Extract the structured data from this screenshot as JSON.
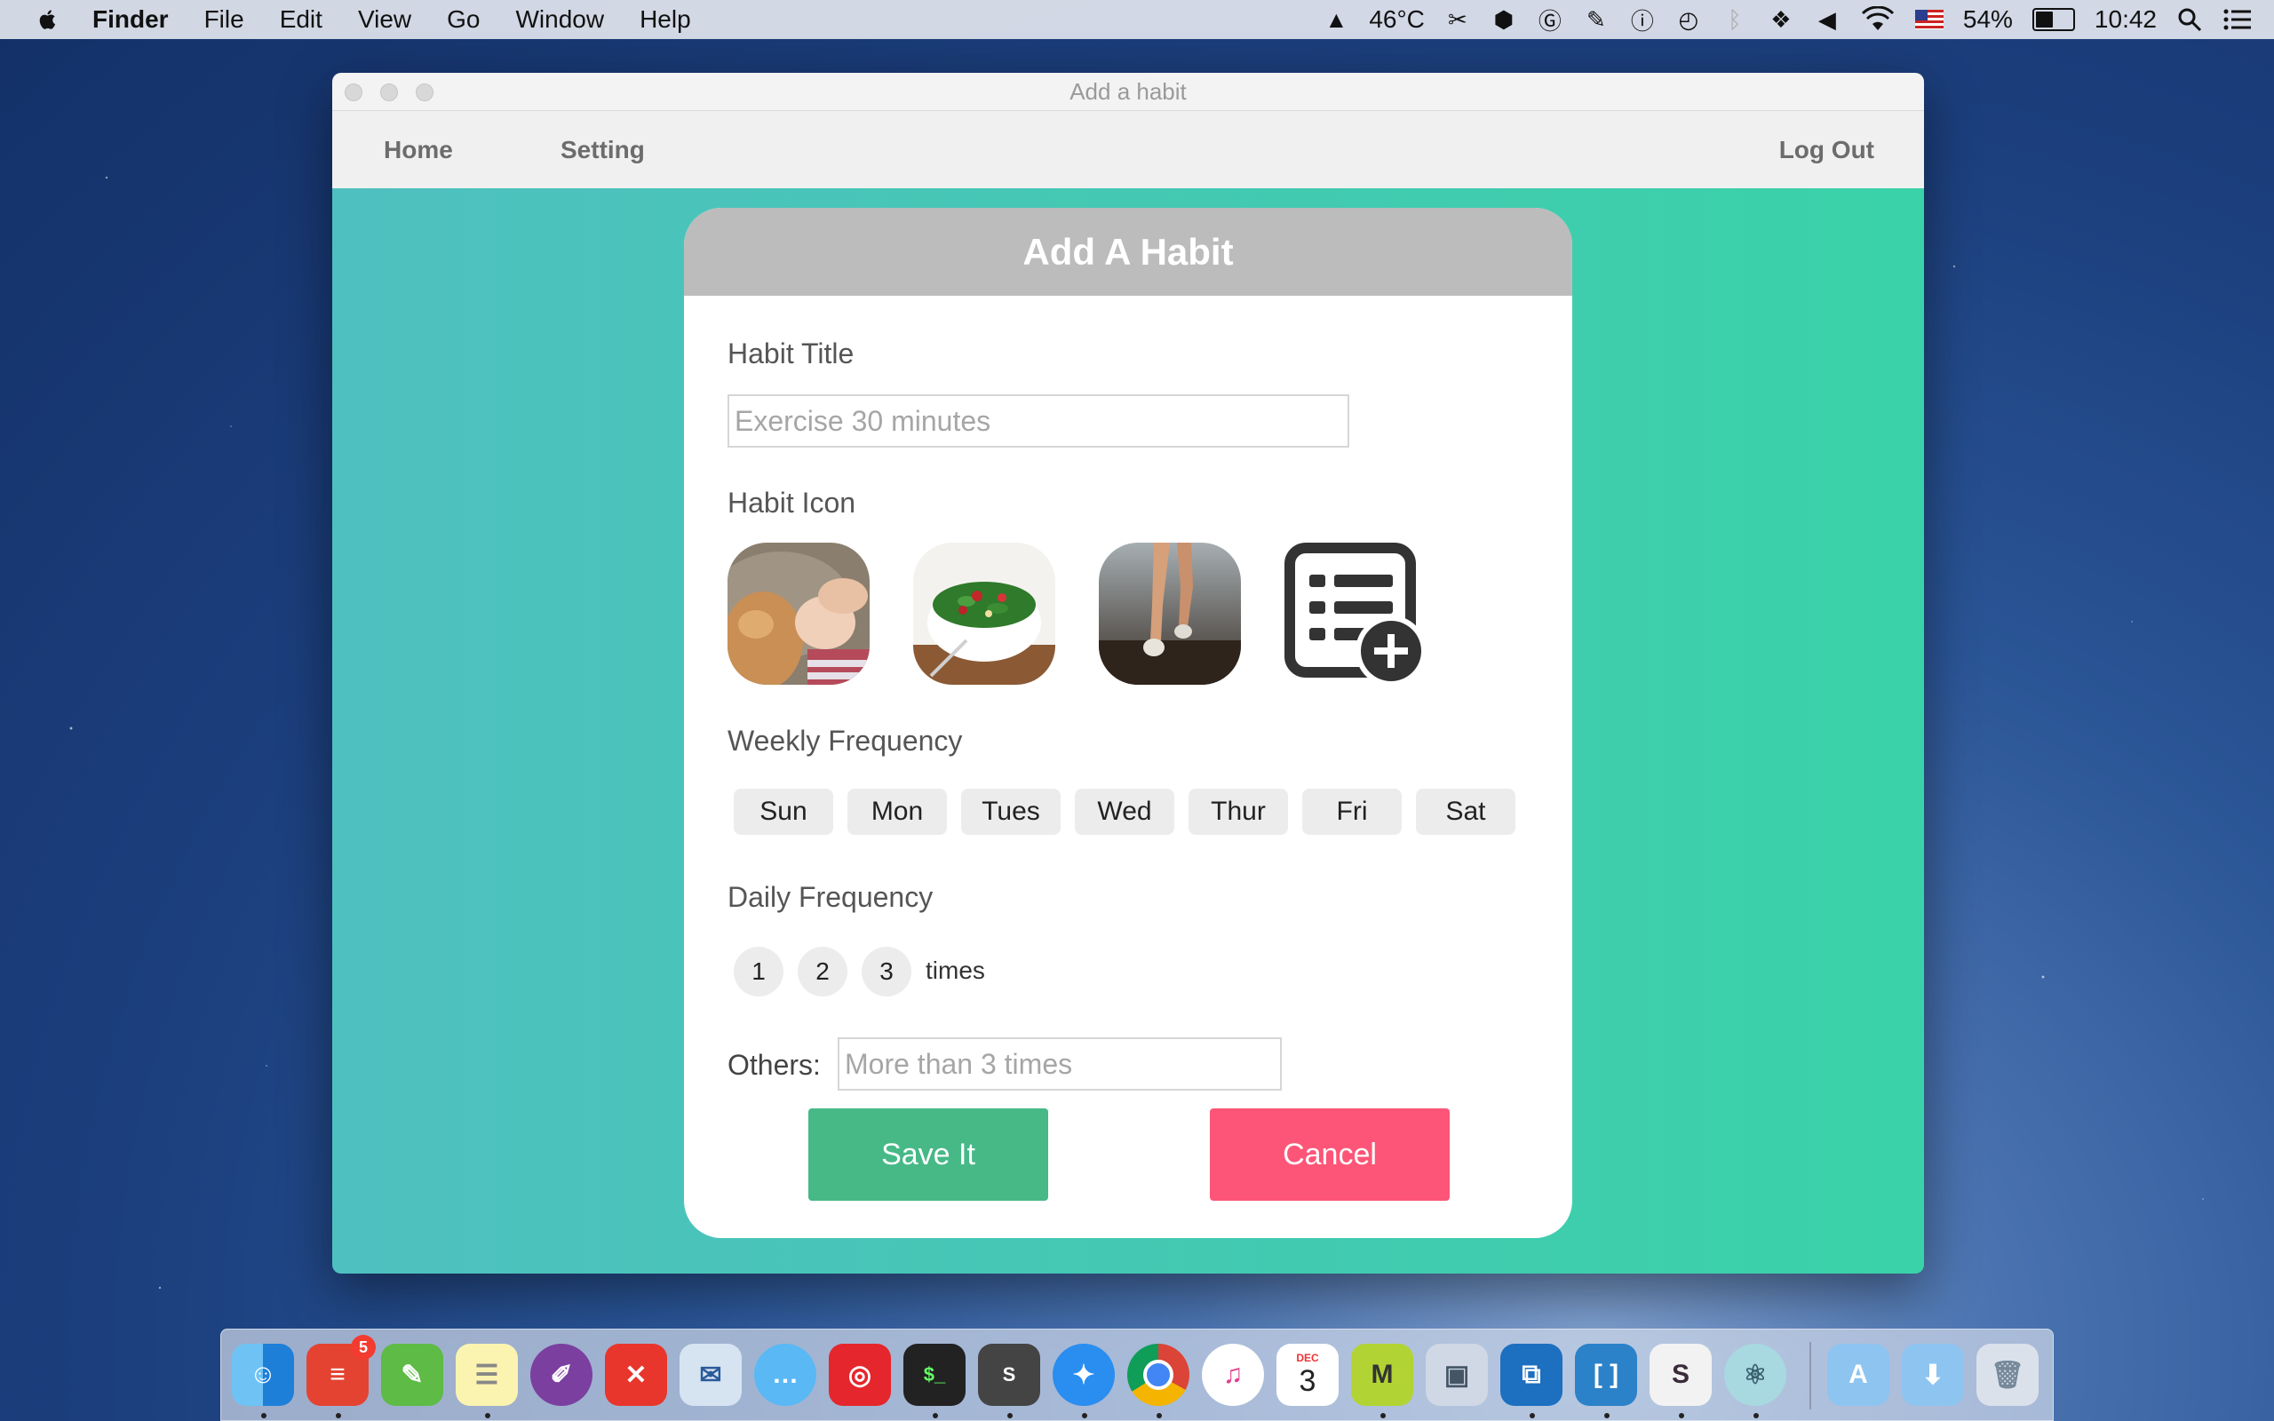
{
  "menubar": {
    "app_name": "Finder",
    "menus": [
      "File",
      "Edit",
      "View",
      "Go",
      "Window",
      "Help"
    ],
    "temperature": "46°C",
    "battery_percent": "54%",
    "battery_level": 0.54,
    "time": "10:42",
    "tray_icons": [
      "drive-icon",
      "scissors-icon",
      "ethernet-icon",
      "circle-g-icon",
      "evernote-icon",
      "info-icon",
      "time-machine-icon",
      "bluetooth-icon",
      "dropbox-icon",
      "volume-icon",
      "wifi-icon",
      "us-flag-icon",
      "battery-icon",
      "search-icon",
      "list-icon"
    ]
  },
  "window": {
    "title": "Add a habit",
    "nav": {
      "home": "Home",
      "setting": "Setting",
      "logout": "Log Out"
    }
  },
  "form": {
    "header": "Add A Habit",
    "title_label": "Habit Title",
    "title_placeholder": "Exercise 30 minutes",
    "icon_label": "Habit Icon",
    "icons": [
      "cat-baby-photo-icon",
      "salad-bowl-photo-icon",
      "running-legs-photo-icon",
      "add-list-icon"
    ],
    "weekly_label": "Weekly Frequency",
    "days": [
      "Sun",
      "Mon",
      "Tues",
      "Wed",
      "Thur",
      "Fri",
      "Sat"
    ],
    "daily_label": "Daily Frequency",
    "counts": [
      "1",
      "2",
      "3"
    ],
    "times_label": "times",
    "others_label": "Others:",
    "others_placeholder": "More than 3 times",
    "save_label": "Save It",
    "cancel_label": "Cancel",
    "colors": {
      "save": "#46b987",
      "cancel": "#fd5577",
      "header": "#bcbcbc",
      "background": "#43c9b2"
    }
  },
  "dock": {
    "apps": [
      "finder-icon",
      "todoist-icon",
      "evernote-icon",
      "notes-icon",
      "onenote-icon",
      "xmind-icon",
      "mail-icon",
      "messages-icon",
      "netease-music-icon",
      "terminal-icon",
      "script-editor-icon",
      "safari-icon",
      "chrome-icon",
      "itunes-icon",
      "calendar-icon",
      "mindnode-icon",
      "preview-icon",
      "vmware-icon",
      "brackets-icon",
      "slack-icon",
      "atom-icon",
      "applications-folder-icon",
      "downloads-folder-icon",
      "trash-icon"
    ],
    "todoist_badge": "5",
    "calendar_month": "DEC",
    "calendar_day": "3"
  }
}
